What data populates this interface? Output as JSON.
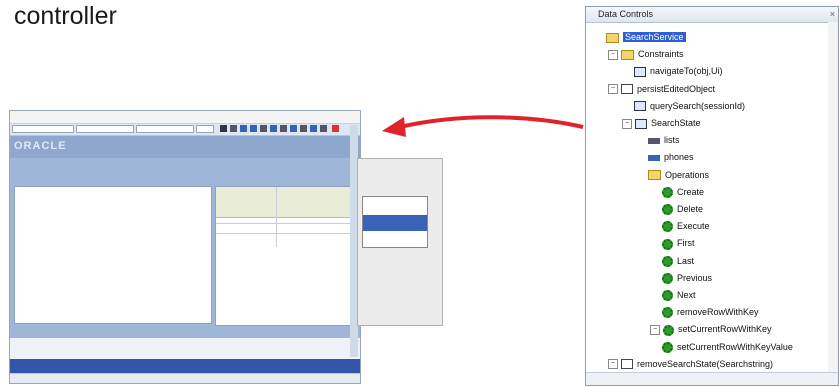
{
  "heading": "controller",
  "app": {
    "brand": "ORACLE"
  },
  "palette": {
    "title": "Data Controls",
    "tree": [
      {
        "label": "SearchService",
        "icon": "folder-ds-icon",
        "indent": 0,
        "selected": true
      },
      {
        "label": "Constraints",
        "icon": "folder-icon",
        "indent": 1,
        "expander": "−"
      },
      {
        "label": "navigateTo(obj,Ui)",
        "icon": "method-icon",
        "indent": 2
      },
      {
        "label": "persistEditedObject",
        "icon": "box-icon",
        "indent": 1,
        "expander": "−"
      },
      {
        "label": "querySearch(sessionId)",
        "icon": "method-icon",
        "indent": 2
      },
      {
        "label": "SearchState",
        "icon": "method-icon",
        "indent": 2,
        "expander": "−"
      },
      {
        "label": "lists",
        "icon": "attr-icon",
        "indent": 3
      },
      {
        "label": "phones",
        "icon": "attr-blue-icon",
        "indent": 3
      },
      {
        "label": "Operations",
        "icon": "folder-icon",
        "indent": 3
      },
      {
        "label": "Create",
        "icon": "gear-icon",
        "indent": 4
      },
      {
        "label": "Delete",
        "icon": "gear-icon",
        "indent": 4
      },
      {
        "label": "Execute",
        "icon": "gear-icon",
        "indent": 4
      },
      {
        "label": "First",
        "icon": "gear-icon",
        "indent": 4
      },
      {
        "label": "Last",
        "icon": "gear-icon",
        "indent": 4
      },
      {
        "label": "Previous",
        "icon": "gear-icon",
        "indent": 4
      },
      {
        "label": "Next",
        "icon": "gear-icon",
        "indent": 4
      },
      {
        "label": "removeRowWithKey",
        "icon": "gear-icon",
        "indent": 4
      },
      {
        "label": "setCurrentRowWithKey",
        "icon": "gear-icon",
        "indent": 4,
        "expander": "−"
      },
      {
        "label": "setCurrentRowWithKeyValue",
        "icon": "gear-icon",
        "indent": 4
      },
      {
        "label": "removeSearchState(Searchstring)",
        "icon": "box-icon",
        "indent": 1,
        "expander": "−"
      }
    ]
  },
  "colors": {
    "arrow": "#e0222a",
    "selection": "#2f5fd0",
    "gear": "#2e9a2e"
  }
}
